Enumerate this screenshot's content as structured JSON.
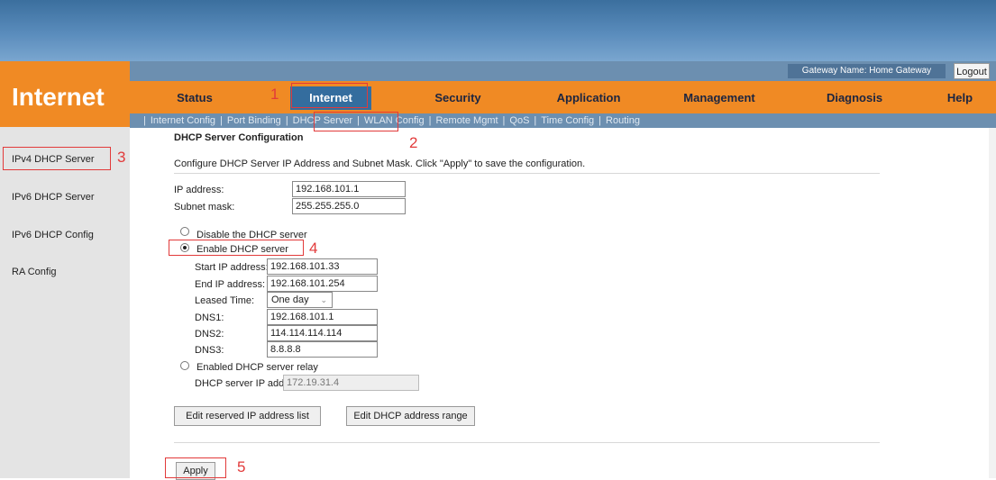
{
  "brand": {
    "title": "Internet"
  },
  "header": {
    "gateway_name": "Gateway Name: Home Gateway",
    "logout": "Logout"
  },
  "tabs": [
    "Status",
    "Internet",
    "Security",
    "Application",
    "Management",
    "Diagnosis",
    "Help"
  ],
  "subtabs": [
    "Internet Config",
    "Port Binding",
    "DHCP Server",
    "WLAN Config",
    "Remote Mgmt",
    "QoS",
    "Time Config",
    "Routing"
  ],
  "sidebar": [
    "IPv4 DHCP Server",
    "IPv6 DHCP Server",
    "IPv6 DHCP Config",
    "RA Config"
  ],
  "annotations": [
    "1",
    "2",
    "3",
    "4",
    "5"
  ],
  "form": {
    "title": "DHCP Server Configuration",
    "description": "Configure DHCP Server IP Address and Subnet Mask. Click \"Apply\" to save the configuration.",
    "ip_label": "IP address:",
    "ip_value": "192.168.101.1",
    "mask_label": "Subnet mask:",
    "mask_value": "255.255.255.0",
    "disable_label": "Disable the DHCP server",
    "enable_label": "Enable DHCP server",
    "start_label": "Start IP address:",
    "start_value": "192.168.101.33",
    "end_label": "End IP address:",
    "end_value": "192.168.101.254",
    "lease_label": "Leased Time:",
    "lease_value": "One day",
    "dns1_label": "DNS1:",
    "dns1_value": "192.168.101.1",
    "dns2_label": "DNS2:",
    "dns2_value": "114.114.114.114",
    "dns3_label": "DNS3:",
    "dns3_value": "8.8.8.8",
    "relay_label": "Enabled DHCP server relay",
    "relay_ip_label": "DHCP server IP address:",
    "relay_ip_value": "172.19.31.4",
    "edit_reserved": "Edit reserved IP address list",
    "edit_range": "Edit DHCP address range",
    "apply": "Apply"
  }
}
